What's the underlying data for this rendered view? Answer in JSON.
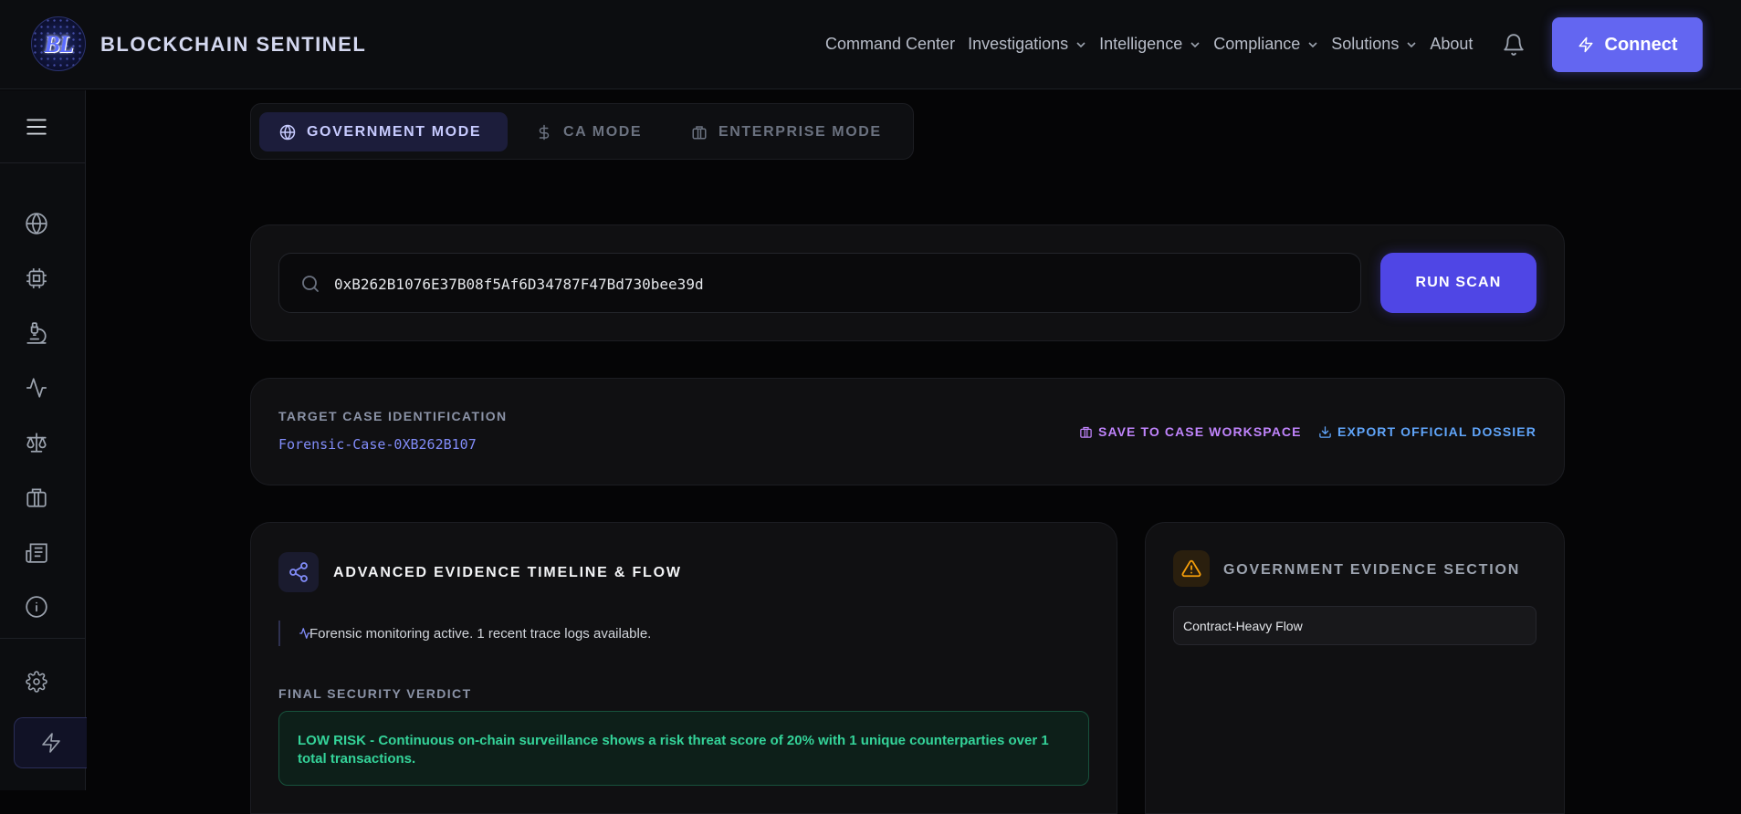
{
  "app": {
    "logo_text": "BL",
    "brand": "BLOCKCHAIN SENTINEL"
  },
  "nav": {
    "items": [
      {
        "label": "Command Center",
        "dropdown": false
      },
      {
        "label": "Investigations",
        "dropdown": true
      },
      {
        "label": "Intelligence",
        "dropdown": true
      },
      {
        "label": "Compliance",
        "dropdown": true
      },
      {
        "label": "Solutions",
        "dropdown": true
      },
      {
        "label": "About",
        "dropdown": false
      }
    ],
    "connect_label": "Connect"
  },
  "sidebar": {
    "icons": [
      "menu-icon",
      "globe-icon",
      "chip-icon",
      "microscope-icon",
      "activity-icon",
      "scales-icon",
      "briefcase-icon",
      "newspaper-icon",
      "info-icon",
      "gear-icon",
      "bolt-icon"
    ]
  },
  "modes": {
    "items": [
      {
        "label": "GOVERNMENT MODE",
        "icon": "globe-icon",
        "active": true
      },
      {
        "label": "CA MODE",
        "icon": "dollar-icon",
        "active": false
      },
      {
        "label": "ENTERPRISE MODE",
        "icon": "briefcase-icon",
        "active": false
      }
    ]
  },
  "search": {
    "value": "0xB262B1076E37B08f5Af6D34787F47Bd730bee39d",
    "button_label": "RUN SCAN"
  },
  "case": {
    "label": "TARGET CASE IDENTIFICATION",
    "id": "Forensic-Case-0XB262B107",
    "save_label": "SAVE TO CASE WORKSPACE",
    "export_label": "EXPORT OFFICIAL DOSSIER"
  },
  "timeline": {
    "title": "ADVANCED EVIDENCE TIMELINE & FLOW",
    "monitor_text": "Forensic monitoring active. 1 recent trace logs available.",
    "verdict_label": "FINAL SECURITY VERDICT",
    "verdict_text": "LOW RISK - Continuous on-chain surveillance shows a risk threat score of 20% with 1 unique counterparties over 1 total transactions."
  },
  "gov_evidence": {
    "title": "GOVERNMENT EVIDENCE SECTION",
    "tag": "Contract-Heavy Flow"
  },
  "colors": {
    "accent": "#6366f1",
    "run_scan": "#4f46e5",
    "save_action": "#c084fc",
    "export_action": "#60a5fa",
    "verdict_text": "#34d399",
    "warning": "#f59e0b"
  }
}
